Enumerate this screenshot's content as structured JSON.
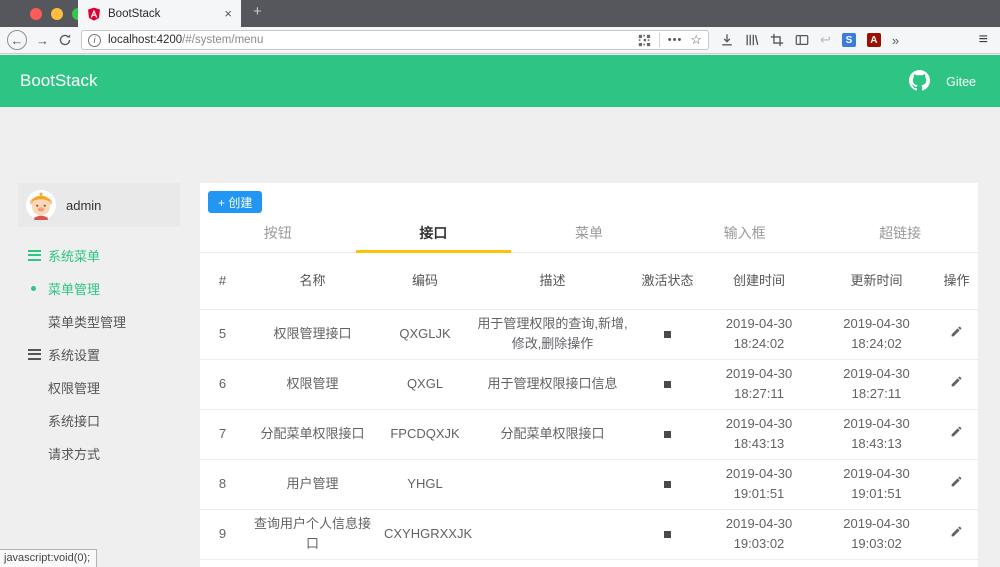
{
  "browser": {
    "tab_title": "BootStack",
    "close_tab_glyph": "×",
    "new_tab_glyph": "+",
    "address": {
      "host": "localhost:4200",
      "path": "/#/system/menu"
    },
    "glyphs": {
      "back": "←",
      "forward": "→",
      "info": "i",
      "ellipsis": "•••",
      "star": "☆",
      "undo": "↩",
      "overflow": "»",
      "menu": "≡",
      "s_ext": "S",
      "pdf_ext": "A"
    },
    "status_text": "javascript:void(0);"
  },
  "appbar": {
    "brand": "BootStack",
    "gitee": "Gitee"
  },
  "sidebar": {
    "username": "admin",
    "items": [
      {
        "label": "系统菜单"
      },
      {
        "label": "菜单管理"
      },
      {
        "label": "菜单类型管理"
      },
      {
        "label": "系统设置"
      },
      {
        "label": "权限管理"
      },
      {
        "label": "系统接口"
      },
      {
        "label": "请求方式"
      }
    ]
  },
  "content": {
    "create_label": "+ 创建",
    "tabs": [
      "按钮",
      "接口",
      "菜单",
      "输入框",
      "超链接"
    ],
    "active_tab": "接口",
    "table": {
      "headers": [
        "#",
        "名称",
        "编码",
        "描述",
        "激活状态",
        "创建时间",
        "更新时间",
        "操作"
      ],
      "rows": [
        {
          "num": "5",
          "name": "权限管理接口",
          "code": "QXGLJK",
          "desc": "用于管理权限的查询,新增,修改,删除操作",
          "active": true,
          "created_date": "2019-04-30",
          "created_time": "18:24:02",
          "updated_date": "2019-04-30",
          "updated_time": "18:24:02"
        },
        {
          "num": "6",
          "name": "权限管理",
          "code": "QXGL",
          "desc": "用于管理权限接口信息",
          "active": true,
          "created_date": "2019-04-30",
          "created_time": "18:27:11",
          "updated_date": "2019-04-30",
          "updated_time": "18:27:11"
        },
        {
          "num": "7",
          "name": "分配菜单权限接口",
          "code": "FPCDQXJK",
          "desc": "分配菜单权限接口",
          "active": true,
          "created_date": "2019-04-30",
          "created_time": "18:43:13",
          "updated_date": "2019-04-30",
          "updated_time": "18:43:13"
        },
        {
          "num": "8",
          "name": "用户管理",
          "code": "YHGL",
          "desc": "",
          "active": true,
          "created_date": "2019-04-30",
          "created_time": "19:01:51",
          "updated_date": "2019-04-30",
          "updated_time": "19:01:51"
        },
        {
          "num": "9",
          "name": "查询用户个人信息接口",
          "code": "CXYHGRXXJK",
          "desc": "",
          "active": true,
          "created_date": "2019-04-30",
          "created_time": "19:03:02",
          "updated_date": "2019-04-30",
          "updated_time": "19:03:02"
        }
      ]
    }
  },
  "colors": {
    "brand_green": "#2EC584",
    "tab_underline": "#FFC107",
    "button_blue": "#2196F3",
    "status_square": "#4A4A4A"
  }
}
